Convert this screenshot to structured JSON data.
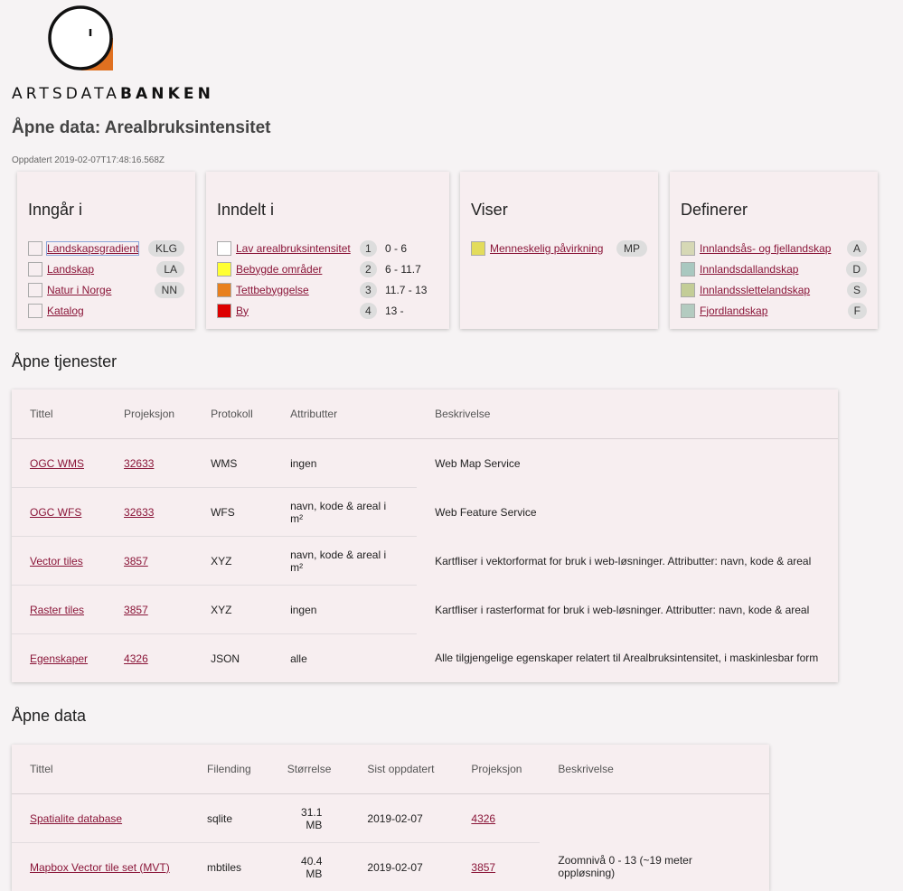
{
  "header": {
    "logo_text_light": "ARTSDATA",
    "logo_text_bold": "BANKEN",
    "title": "Åpne data: Arealbruksintensitet",
    "updated": "Oppdatert 2019-02-07T17:48:16.568Z"
  },
  "cards": {
    "inngar": {
      "title": "Inngår i",
      "items": [
        {
          "label": "Landskapsgradient",
          "code": "KLG"
        },
        {
          "label": "Landskap",
          "code": "LA"
        },
        {
          "label": "Natur i Norge",
          "code": "NN"
        },
        {
          "label": "Katalog",
          "code": ""
        }
      ]
    },
    "inndelt": {
      "title": "Inndelt i",
      "items": [
        {
          "label": "Lav arealbruksintensitet",
          "num": "1",
          "range": "0 - 6",
          "color": "#ffffff"
        },
        {
          "label": "Bebygde områder",
          "num": "2",
          "range": "6 - 11.7",
          "color": "#ffff33"
        },
        {
          "label": "Tettbebyggelse",
          "num": "3",
          "range": "11.7 - 13",
          "color": "#e8801e"
        },
        {
          "label": "By",
          "num": "4",
          "range": "13 -",
          "color": "#dd0000"
        }
      ]
    },
    "viser": {
      "title": "Viser",
      "items": [
        {
          "label": "Menneskelig påvirkning",
          "code": "MP",
          "color": "#e3dc5b"
        }
      ]
    },
    "definerer": {
      "title": "Definerer",
      "items": [
        {
          "label": "Innlandsås- og fjellandskap",
          "code": "A",
          "color": "#d6d8b5"
        },
        {
          "label": "Innlandsdallandskap",
          "code": "D",
          "color": "#a9c8c0"
        },
        {
          "label": "Innlandsslettelandskap",
          "code": "S",
          "color": "#c3cd97"
        },
        {
          "label": "Fjordlandskap",
          "code": "F",
          "color": "#b3cbc0"
        }
      ]
    }
  },
  "services": {
    "title": "Åpne tjenester",
    "headers": [
      "Tittel",
      "Projeksjon",
      "Protokoll",
      "Attributter",
      "Beskrivelse"
    ],
    "rows": [
      {
        "title": "OGC WMS",
        "proj": "32633",
        "protocol": "WMS",
        "attrs": "ingen",
        "desc": "Web Map Service"
      },
      {
        "title": "OGC WFS",
        "proj": "32633",
        "protocol": "WFS",
        "attrs": "navn, kode & areal i m²",
        "desc": "Web Feature Service"
      },
      {
        "title": "Vector tiles",
        "proj": "3857",
        "protocol": "XYZ",
        "attrs": "navn, kode & areal i m²",
        "desc": "Kartfliser i vektorformat for bruk i web-løsninger. Attributter: navn, kode & areal"
      },
      {
        "title": "Raster tiles",
        "proj": "3857",
        "protocol": "XYZ",
        "attrs": "ingen",
        "desc": "Kartfliser i rasterformat for bruk i web-løsninger. Attributter: navn, kode & areal"
      },
      {
        "title": "Egenskaper",
        "proj": "4326",
        "protocol": "JSON",
        "attrs": "alle",
        "desc": "Alle tilgjengelige egenskaper relatert til Arealbruksintensitet, i maskinlesbar form"
      }
    ]
  },
  "data": {
    "title": "Åpne data",
    "headers": [
      "Tittel",
      "Filending",
      "Størrelse",
      "Sist oppdatert",
      "Projeksjon",
      "Beskrivelse"
    ],
    "rows": [
      {
        "title": "Spatialite database",
        "ext": "sqlite",
        "size": "31.1 MB",
        "updated": "2019-02-07",
        "proj": "4326",
        "desc": ""
      },
      {
        "title": "Mapbox Vector tile set (MVT)",
        "ext": "mbtiles",
        "size": "40.4 MB",
        "updated": "2019-02-07",
        "proj": "3857",
        "desc": "Zoomnivå 0 - 13 (~19 meter oppløsning)"
      }
    ]
  },
  "colors": {
    "link": "#8a1538",
    "card_bg": "#f7eef0",
    "page_bg": "#f6f3f4",
    "logo_accent": "#e07020"
  }
}
